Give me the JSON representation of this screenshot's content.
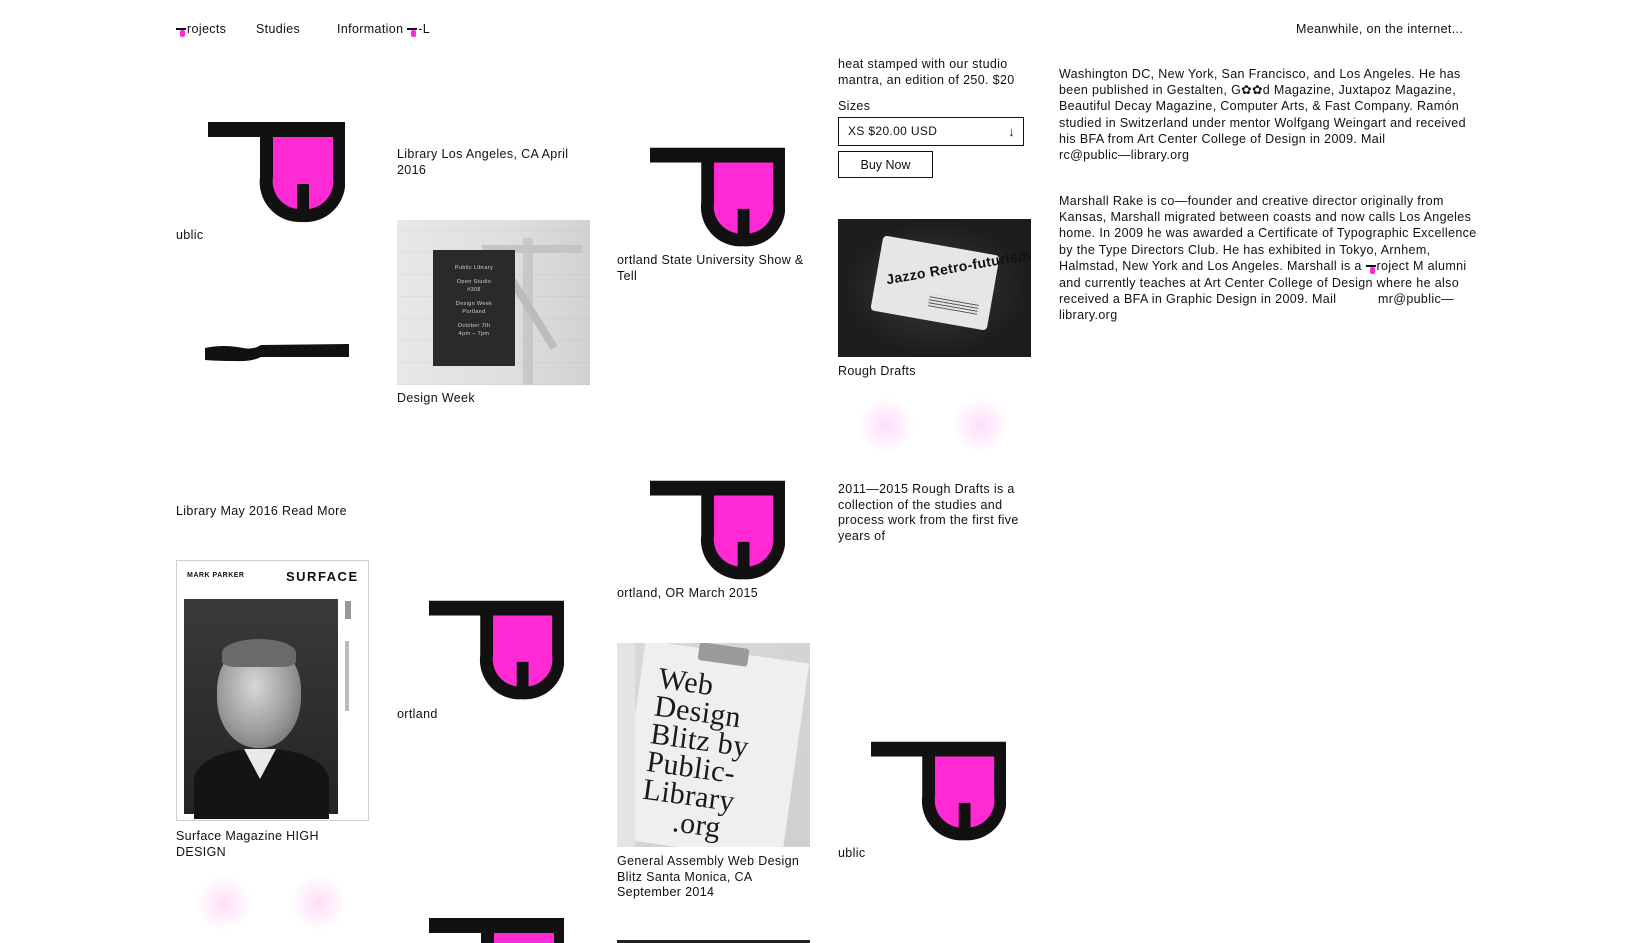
{
  "colors": {
    "accent": "#ff2ad4",
    "ink": "#111111",
    "background": "#ffffff"
  },
  "nav": {
    "projects": "rojects",
    "studies": "Studies",
    "information": "Information",
    "pl_suffix": "-L",
    "meanwhile": "Meanwhile, on the internet..."
  },
  "col1": {
    "ublic_top": "ublic",
    "library_may": "Library May 2016 Read More",
    "surface_caption": "Surface Magazine HIGH DESIGN",
    "surface_cover": {
      "name": "MARK PARKER",
      "title": "SURFACE"
    }
  },
  "col2": {
    "library_la": "Library Los Angeles, CA April 2016",
    "design_week": "Design Week",
    "poster_lines": [
      "Public Library",
      "Open Studio",
      "#308",
      "Design Week",
      "Portland",
      "October 7th",
      "4pm – 7pm"
    ],
    "ortland": "ortland"
  },
  "col3": {
    "portland_state": "ortland State University Show & Tell",
    "portland_or": "ortland, OR March 2015",
    "general_assembly": "General Assembly Web Design Blitz Santa Monica, CA September 2014",
    "clipboard_text": [
      "Web",
      "Design",
      "Blitz by",
      "Public-",
      "Library",
      ".org"
    ]
  },
  "col4": {
    "heat_stamped": "heat stamped with our studio mantra, an edition of 250. $20",
    "sizes_label": "Sizes",
    "size_selected": "XS $20.00 USD",
    "buy_now": "Buy Now",
    "rough_drafts": "Rough Drafts",
    "rough_desc": "2011—2015 Rough Drafts is a collection of the studies and process work from the first five years of",
    "ublic_bottom": "ublic",
    "book_text": "Jazzo Retro-futurism"
  },
  "bio": {
    "p1": "Washington DC, New York, San Francisco, and Los Angeles. He has been published in Gestalten, G✿✿d Magazine, Juxtapoz Magazine, Beautiful Decay Magazine, Computer Arts, & Fast Company. Ramón studied in Switzerland under mentor Wolfgang Weingart and received his BFA from Art Center College of Design in 2009. Mail",
    "p1_email": "rc@public—library.org",
    "p2a": "Marshall Rake is co—founder and creative director originally from Kansas, Marshall migrated between coasts and now calls Los Angeles home. In 2009 he was awarded a Certificate of Typographic Excellence by the Type Directors Club. He has exhibited in Tokyo, Arnhem, Halmstad, New York and Los Angeles. Marshall is a",
    "p2b": "roject M alumni and currently teaches at Art Center College of Design where he also received a BFA in Graphic Design in 2009. Mail",
    "p2_email": "mr@public—library.org"
  }
}
